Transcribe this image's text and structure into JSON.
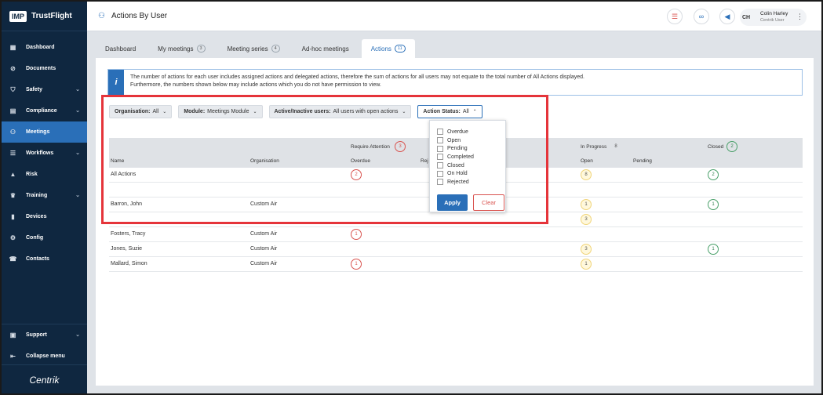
{
  "sidebar": {
    "logo": "IMP",
    "app_name": "TrustFlight",
    "items": [
      {
        "label": "Dashboard",
        "icon": "dashboard-icon",
        "glyph": "▦",
        "chevron": false,
        "active": false
      },
      {
        "label": "Documents",
        "icon": "paperclip-icon",
        "glyph": "⊘",
        "chevron": false,
        "active": false
      },
      {
        "label": "Safety",
        "icon": "shield-icon",
        "glyph": "⛉",
        "chevron": true,
        "active": false
      },
      {
        "label": "Compliance",
        "icon": "clipboard-icon",
        "glyph": "▤",
        "chevron": true,
        "active": false
      },
      {
        "label": "Meetings",
        "icon": "meetings-icon",
        "glyph": "⚇",
        "chevron": false,
        "active": true
      },
      {
        "label": "Workflows",
        "icon": "workflow-icon",
        "glyph": "☰",
        "chevron": true,
        "active": false
      },
      {
        "label": "Risk",
        "icon": "risk-icon",
        "glyph": "▲",
        "chevron": false,
        "active": false
      },
      {
        "label": "Training",
        "icon": "graduation-icon",
        "glyph": "♛",
        "chevron": true,
        "active": false
      },
      {
        "label": "Devices",
        "icon": "devices-icon",
        "glyph": "▮",
        "chevron": false,
        "active": false
      },
      {
        "label": "Config",
        "icon": "config-icon",
        "glyph": "⚙",
        "chevron": false,
        "active": false
      },
      {
        "label": "Contacts",
        "icon": "contacts-icon",
        "glyph": "☎",
        "chevron": false,
        "active": false
      }
    ],
    "support": "Support",
    "collapse": "Collapse menu",
    "footer_brand": "Centrik"
  },
  "header": {
    "title": "Actions By User",
    "user_initials": "CH",
    "user_name": "Colin Harley",
    "user_role": "Centrik User"
  },
  "tabs": [
    {
      "label": "Dashboard",
      "badge": "",
      "active": false
    },
    {
      "label": "My meetings",
      "badge": "3",
      "active": false
    },
    {
      "label": "Meeting series",
      "badge": "4",
      "active": false
    },
    {
      "label": "Ad-hoc meetings",
      "badge": "",
      "active": false
    },
    {
      "label": "Actions",
      "badge": "11",
      "active": true
    }
  ],
  "info": {
    "line1": "The number of actions for each user includes assigned actions and delegated actions, therefore the sum of actions for all users may not equate to the total number of All Actions displayed.",
    "line2": "Furthermore, the numbers shown below may include actions which you do not have permission to view."
  },
  "filters": {
    "organisation": {
      "label": "Organisation:",
      "value": "All"
    },
    "module": {
      "label": "Module:",
      "value": "Meetings Module"
    },
    "active": {
      "label": "Active/Inactive users:",
      "value": "All users with open actions"
    },
    "status": {
      "label": "Action Status:",
      "value": "All"
    }
  },
  "table": {
    "group_require": "Require Attention",
    "group_require_count": "3",
    "group_progress": "In Progress",
    "group_progress_count": "8",
    "group_closed": "Closed",
    "group_closed_count": "2",
    "col_name": "Name",
    "col_org": "Organisation",
    "col_overdue": "Overdue",
    "col_rej": "Rej",
    "col_open": "Open",
    "col_pending": "Pending",
    "rows": [
      {
        "name": "All Actions",
        "org": "",
        "overdue": "2",
        "open": "8",
        "closed": "2"
      },
      {
        "name": "",
        "org": "",
        "overdue": "",
        "open": "",
        "closed": ""
      },
      {
        "name": "Barron, John",
        "org": "Custom Air",
        "overdue": "",
        "open": "1",
        "closed": "1"
      },
      {
        "name": "",
        "org": "",
        "overdue": "",
        "open": "3",
        "closed": ""
      },
      {
        "name": "Fosters, Tracy",
        "org": "Custom Air",
        "overdue": "1",
        "open": "",
        "closed": ""
      },
      {
        "name": "Jones, Suzie",
        "org": "Custom Air",
        "overdue": "",
        "open": "3",
        "closed": "1"
      },
      {
        "name": "Mallard, Simon",
        "org": "Custom Air",
        "overdue": "1",
        "open": "1",
        "closed": ""
      }
    ]
  },
  "status_options": [
    "Overdue",
    "Open",
    "Pending",
    "Completed",
    "Closed",
    "On Hold",
    "Rejected"
  ],
  "apply_label": "Apply",
  "clear_label": "Clear"
}
